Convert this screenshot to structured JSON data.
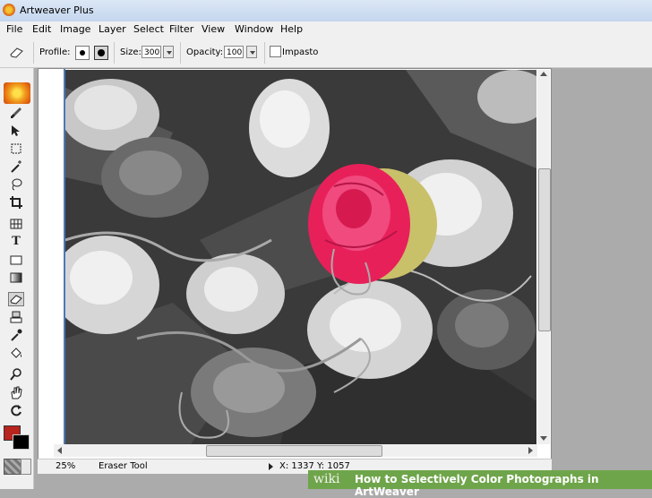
{
  "window": {
    "title": "Artweaver Plus"
  },
  "menu": [
    "File",
    "Edit",
    "Image",
    "Layer",
    "Select",
    "Filter",
    "View",
    "Window",
    "Help"
  ],
  "options": {
    "profile_label": "Profile:",
    "size_label": "Size:",
    "size_value": "300",
    "opacity_label": "Opacity:",
    "opacity_value": "100",
    "impasto_label": "Impasto",
    "impasto_checked": false
  },
  "tools": [
    "paintbrush-icon",
    "move-icon",
    "rectangle-select-icon",
    "magic-wand-icon",
    "lasso-icon",
    "crop-icon",
    "grid-icon",
    "text-icon",
    "rectangle-icon",
    "gradient-icon",
    "eraser-icon",
    "clone-icon",
    "eyedropper-icon",
    "paint-bucket-icon",
    "zoom-icon",
    "hand-icon",
    "rotate-icon"
  ],
  "active_tool": "eraser-icon",
  "colors": {
    "foreground": "#b8241e",
    "background": "#000000",
    "accent": "#e8205a"
  },
  "status": {
    "zoom": "25%",
    "tool": "Eraser Tool",
    "coords": "X: 1337  Y: 1057"
  },
  "watermark": {
    "logo": "wiki",
    "title": "How to Selectively Color Photographs in ArtWeaver"
  }
}
